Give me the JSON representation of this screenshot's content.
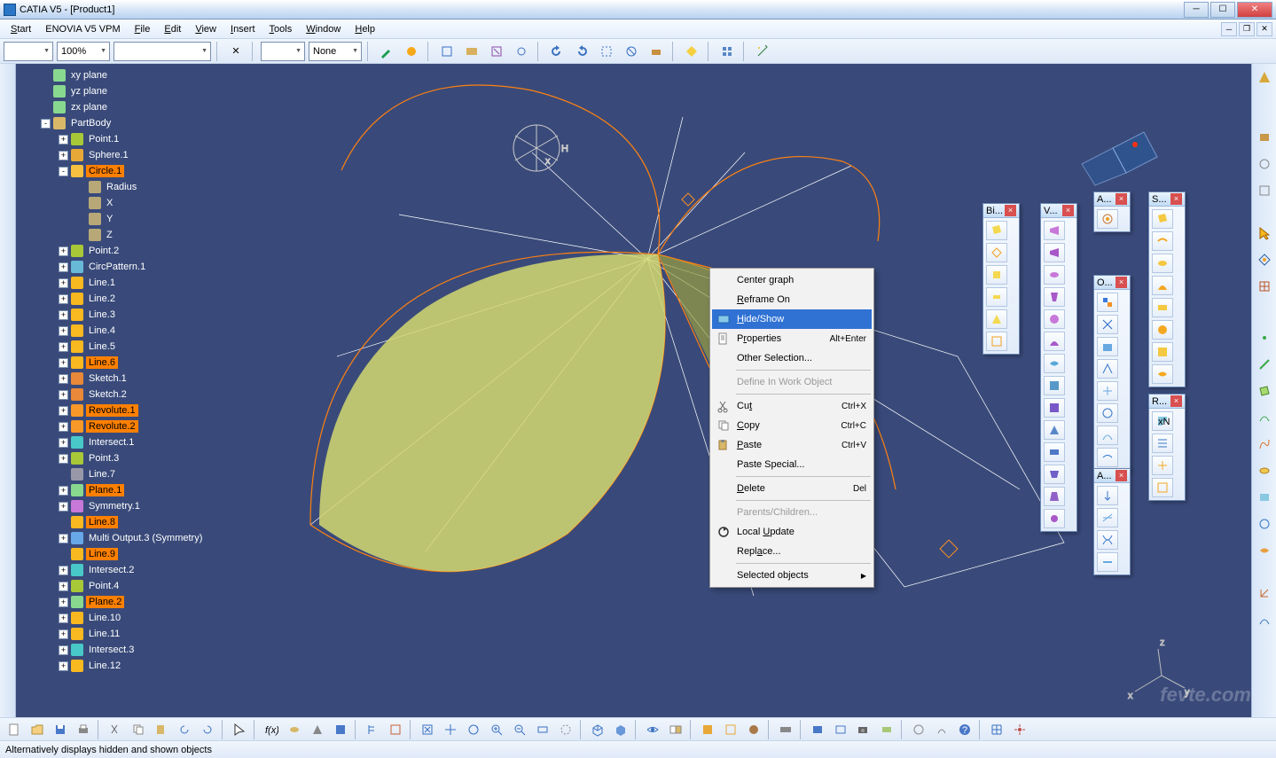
{
  "title": "CATIA V5 - [Product1]",
  "menu": {
    "start": "Start",
    "enovia": "ENOVIA V5 VPM",
    "file": "File",
    "edit": "Edit",
    "view": "View",
    "insert": "Insert",
    "tools": "Tools",
    "window": "Window",
    "help": "Help"
  },
  "toolbar": {
    "zoom": "100%",
    "none": "None",
    "blank": ""
  },
  "tree": [
    {
      "d": 0,
      "lbl": "xy plane",
      "icon": "plane"
    },
    {
      "d": 0,
      "lbl": "yz plane",
      "icon": "plane"
    },
    {
      "d": 0,
      "lbl": "zx plane",
      "icon": "plane"
    },
    {
      "d": 0,
      "lbl": "PartBody",
      "icon": "body",
      "exp": "-"
    },
    {
      "d": 1,
      "lbl": "Point.1",
      "icon": "point",
      "exp": "+"
    },
    {
      "d": 1,
      "lbl": "Sphere.1",
      "icon": "sphere",
      "exp": "+"
    },
    {
      "d": 1,
      "lbl": "Circle.1",
      "icon": "circle",
      "exp": "-",
      "sel": true
    },
    {
      "d": 2,
      "lbl": "Radius",
      "icon": "param"
    },
    {
      "d": 2,
      "lbl": "X",
      "icon": "param"
    },
    {
      "d": 2,
      "lbl": "Y",
      "icon": "param"
    },
    {
      "d": 2,
      "lbl": "Z",
      "icon": "param"
    },
    {
      "d": 1,
      "lbl": "Point.2",
      "icon": "point",
      "exp": "+"
    },
    {
      "d": 1,
      "lbl": "CircPattern.1",
      "icon": "pattern",
      "exp": "+"
    },
    {
      "d": 1,
      "lbl": "Line.1",
      "icon": "line",
      "exp": "+"
    },
    {
      "d": 1,
      "lbl": "Line.2",
      "icon": "line",
      "exp": "+"
    },
    {
      "d": 1,
      "lbl": "Line.3",
      "icon": "line",
      "exp": "+"
    },
    {
      "d": 1,
      "lbl": "Line.4",
      "icon": "line",
      "exp": "+"
    },
    {
      "d": 1,
      "lbl": "Line.5",
      "icon": "line",
      "exp": "+"
    },
    {
      "d": 1,
      "lbl": "Line.6",
      "icon": "line",
      "exp": "+",
      "sel": true
    },
    {
      "d": 1,
      "lbl": "Sketch.1",
      "icon": "sketch",
      "exp": "+"
    },
    {
      "d": 1,
      "lbl": "Sketch.2",
      "icon": "sketch",
      "exp": "+"
    },
    {
      "d": 1,
      "lbl": "Revolute.1",
      "icon": "revolute",
      "exp": "+",
      "sel": true
    },
    {
      "d": 1,
      "lbl": "Revolute.2",
      "icon": "revolute",
      "exp": "+",
      "sel": true
    },
    {
      "d": 1,
      "lbl": "Intersect.1",
      "icon": "intersect",
      "exp": "+"
    },
    {
      "d": 1,
      "lbl": "Point.3",
      "icon": "point",
      "exp": "+"
    },
    {
      "d": 1,
      "lbl": "Line.7",
      "icon": "lineg"
    },
    {
      "d": 1,
      "lbl": "Plane.1",
      "icon": "plane",
      "exp": "+",
      "sel": true
    },
    {
      "d": 1,
      "lbl": "Symmetry.1",
      "icon": "symmetry",
      "exp": "+"
    },
    {
      "d": 1,
      "lbl": "Line.8",
      "icon": "line",
      "sel": true
    },
    {
      "d": 1,
      "lbl": "Multi Output.3 (Symmetry)",
      "icon": "multi",
      "exp": "+"
    },
    {
      "d": 1,
      "lbl": "Line.9",
      "icon": "line",
      "sel": true
    },
    {
      "d": 1,
      "lbl": "Intersect.2",
      "icon": "intersect",
      "exp": "+"
    },
    {
      "d": 1,
      "lbl": "Point.4",
      "icon": "point",
      "exp": "+"
    },
    {
      "d": 1,
      "lbl": "Plane.2",
      "icon": "plane",
      "exp": "+",
      "sel": true
    },
    {
      "d": 1,
      "lbl": "Line.10",
      "icon": "line",
      "exp": "+"
    },
    {
      "d": 1,
      "lbl": "Line.11",
      "icon": "line",
      "exp": "+"
    },
    {
      "d": 1,
      "lbl": "Intersect.3",
      "icon": "intersect",
      "exp": "+"
    },
    {
      "d": 1,
      "lbl": "Line.12",
      "icon": "line",
      "exp": "+"
    }
  ],
  "context": {
    "center_graph": "Center graph",
    "reframe_on": "Reframe On",
    "hide_show": "Hide/Show",
    "properties": "Properties",
    "properties_sc": "Alt+Enter",
    "other_sel": "Other Selection...",
    "define_work": "Define In Work Object",
    "cut": "Cut",
    "cut_sc": "Ctrl+X",
    "copy": "Copy",
    "copy_sc": "Ctrl+C",
    "paste": "Paste",
    "paste_sc": "Ctrl+V",
    "paste_special": "Paste Special...",
    "delete": "Delete",
    "delete_sc": "Del",
    "parents": "Parents/Children...",
    "local_update": "Local Update",
    "replace": "Replace...",
    "selected_obj": "Selected objects"
  },
  "palettes": {
    "bi": "Bi...",
    "v": "V...",
    "a1": "A...",
    "s": "S...",
    "o": "O...",
    "r": "R...",
    "a2": "A..."
  },
  "status": "Alternatively displays hidden and shown objects",
  "watermark": "fevte.com"
}
